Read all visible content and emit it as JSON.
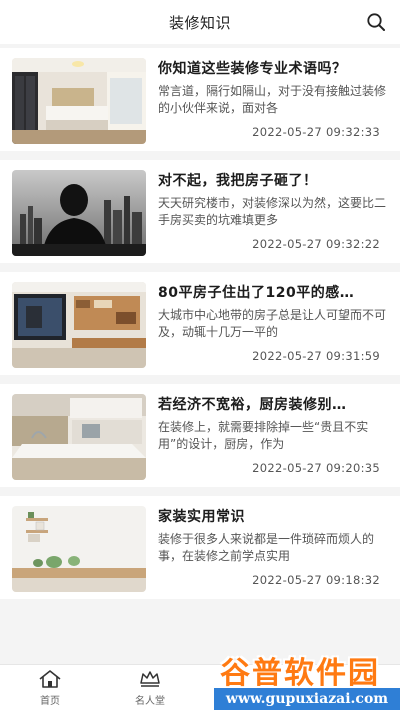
{
  "header": {
    "title": "装修知识",
    "search_icon": "search-icon"
  },
  "articles": [
    {
      "title": "你知道这些装修专业术语吗？",
      "summary": "常言道，隔行如隔山，对于没有接触过装修的小伙伴来说，面对各",
      "time": "2022-05-27 09:32:33"
    },
    {
      "title": "对不起，我把房子砸了！",
      "summary": "天天研究楼市，对装修深以为然，这要比二手房买卖的坑难填更多",
      "time": "2022-05-27 09:32:22"
    },
    {
      "title": "80平房子住出了120平的感…",
      "summary": "大城市中心地带的房子总是让人可望而不可及，动辄十几万一平的",
      "time": "2022-05-27 09:31:59"
    },
    {
      "title": "若经济不宽裕，厨房装修别…",
      "summary": "在装修上，就需要排除掉一些“贵且不实用”的设计，厨房，作为",
      "time": "2022-05-27 09:20:35"
    },
    {
      "title": "家装实用常识",
      "summary": "装修于很多人来说都是一件琐碎而烦人的事，在装修之前学点实用",
      "time": "2022-05-27 09:18:32"
    }
  ],
  "tabbar": {
    "tabs": [
      {
        "label": "首页",
        "icon": "home-icon"
      },
      {
        "label": "名人堂",
        "icon": "crown-icon"
      }
    ]
  },
  "watermark": {
    "text": "谷普软件园",
    "url": "www.gupuxiazai.com"
  }
}
